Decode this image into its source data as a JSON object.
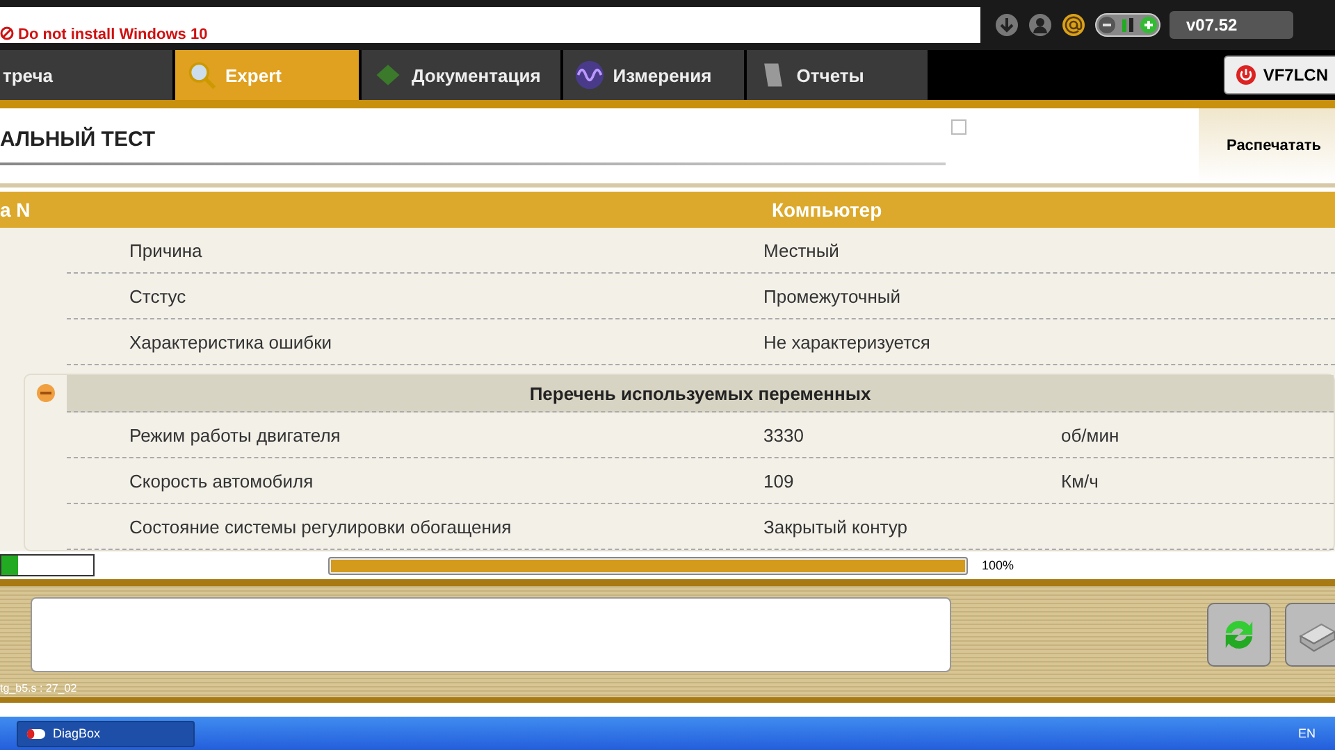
{
  "top_bar": {
    "notice": "Do not install Windows 10",
    "version": "v07.52"
  },
  "tabs": [
    {
      "label": "треча",
      "selected": false
    },
    {
      "label": "Expert",
      "selected": true
    },
    {
      "label": "Документация",
      "selected": false
    },
    {
      "label": "Измерения",
      "selected": false
    },
    {
      "label": "Отчеты",
      "selected": false
    }
  ],
  "vehicle_button": "VF7LCN",
  "page_title": "АЛЬНЫЙ ТЕСТ",
  "print_button": "Распечатать",
  "table": {
    "columns": [
      "a N",
      "Компьютер"
    ],
    "fault_rows": [
      {
        "name": "Причина",
        "value": "Местный"
      },
      {
        "name": "Стстус",
        "value": "Промежуточный"
      },
      {
        "name": "Характеристика ошибки",
        "value": "Не характеризуется"
      }
    ],
    "variables": {
      "title": "Перечень используемых переменных",
      "expanded": true,
      "rows": [
        {
          "name": "Режим работы двигателя",
          "value": "3330",
          "unit": "об/мин"
        },
        {
          "name": "Скорость автомобиля",
          "value": "109",
          "unit": "Км/ч"
        },
        {
          "name": "Состояние системы регулировки обогащения",
          "value": "Закрытый контур",
          "unit": ""
        }
      ]
    }
  },
  "progress": {
    "level": 1,
    "reading": "100%"
  },
  "status_code": "tg_b5.s : 27_02",
  "taskbar": {
    "app": "DiagBox",
    "language": "EN"
  }
}
